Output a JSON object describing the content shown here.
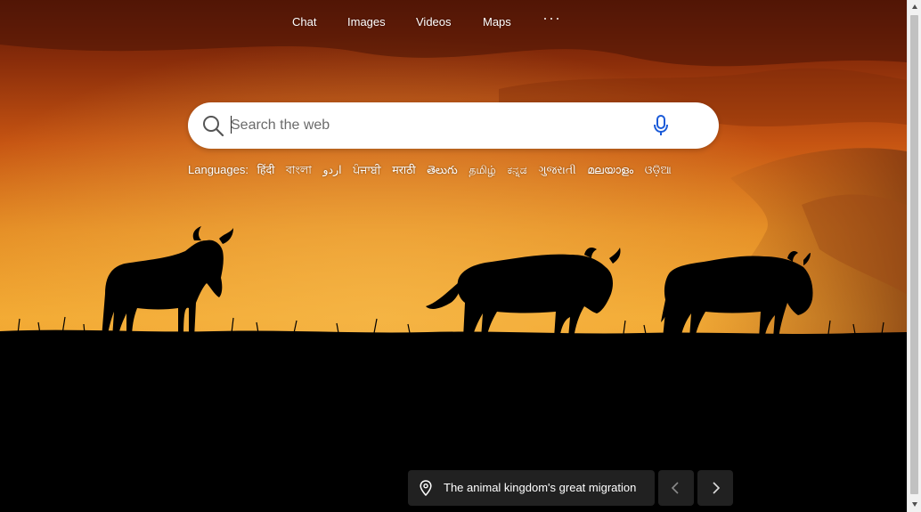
{
  "topnav": {
    "items": [
      {
        "label": "Chat"
      },
      {
        "label": "Images"
      },
      {
        "label": "Videos"
      },
      {
        "label": "Maps"
      }
    ],
    "more_icon": "ellipsis-icon"
  },
  "search": {
    "placeholder": "Search the web",
    "value": "",
    "search_icon": "search-icon",
    "mic_icon": "microphone-icon"
  },
  "languages": {
    "label": "Languages:",
    "links": [
      "हिंदी",
      "বাংলা",
      "اردو",
      "ਪੰਜਾਬੀ",
      "मराठी",
      "తెలుగు",
      "தமிழ்",
      "ಕನ್ನಡ",
      "ગુજરાતી",
      "മലയാളം",
      "ଓଡ଼ିଆ"
    ]
  },
  "caption": {
    "text": "The animal kingdom's great migration",
    "icon": "location-pin-icon"
  },
  "carousel": {
    "prev_icon": "chevron-left-icon",
    "next_icon": "chevron-right-icon"
  },
  "colors": {
    "sky_top": "#6b1f08",
    "sky_mid": "#d9661a",
    "sky_glow": "#f0a530",
    "ground": "#000000",
    "mic_blue": "#1a5ad8",
    "caption_bg": "#262626"
  }
}
